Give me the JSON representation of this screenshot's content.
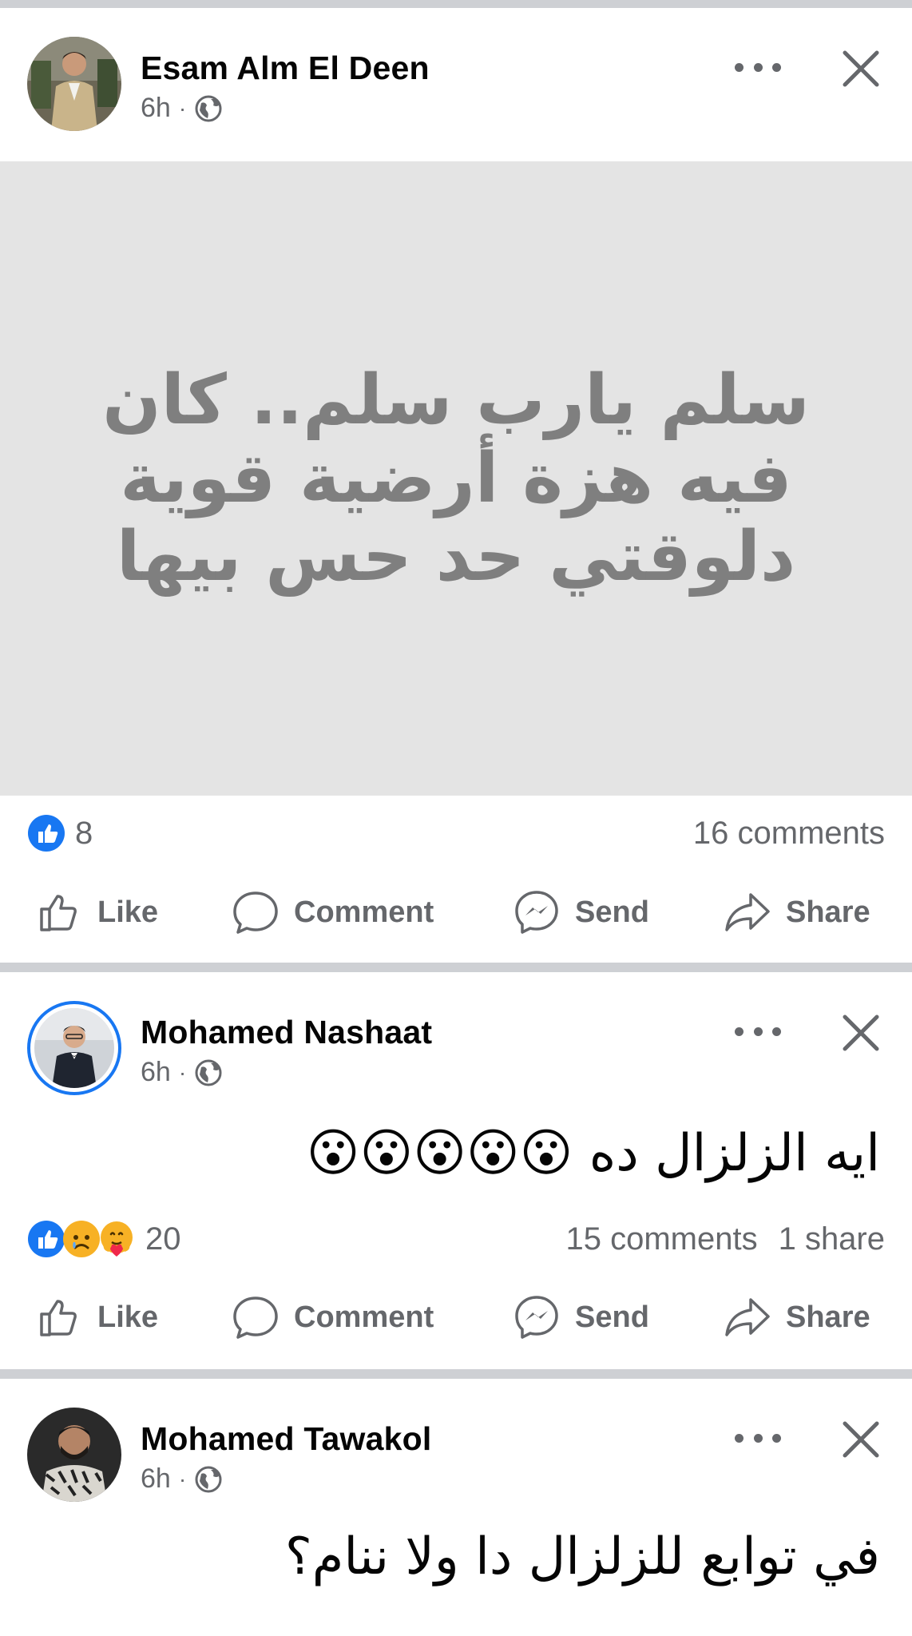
{
  "posts": [
    {
      "author": "Esam Alm El Deen",
      "time": "6h",
      "privacy_icon": "globe-icon",
      "background_text": "سلم يارب سلم.. كان فيه هزة أرضية قوية دلوقتي حد حس بيها",
      "reactions": [
        "like"
      ],
      "reaction_count": "8",
      "comments": "16 comments",
      "shares": "",
      "actions": {
        "like": "Like",
        "comment": "Comment",
        "send": "Send",
        "share": "Share"
      }
    },
    {
      "author": "Mohamed Nashaat",
      "time": "6h",
      "privacy_icon": "globe-icon",
      "text": "ايه الزلزال ده 😮😮😮😮😮",
      "reactions": [
        "like",
        "sad",
        "care"
      ],
      "reaction_count": "20",
      "comments": "15 comments",
      "shares": "1 share",
      "actions": {
        "like": "Like",
        "comment": "Comment",
        "send": "Send",
        "share": "Share"
      }
    },
    {
      "author": "Mohamed Tawakol",
      "time": "6h",
      "privacy_icon": "globe-icon",
      "text": "في توابع للزلزال دا ولا ننام؟"
    }
  ],
  "colors": {
    "accent": "#1877f2",
    "secondary_text": "#65676b",
    "divider": "#ced0d4",
    "card_background": "#e4e4e4",
    "card_text": "#7f7f7f"
  },
  "menu_icons": {
    "more": "more-horizontal-icon",
    "close": "close-icon"
  }
}
